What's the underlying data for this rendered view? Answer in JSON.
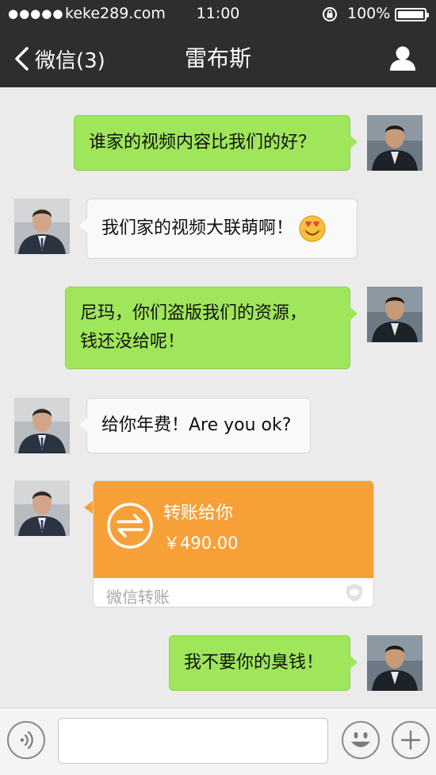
{
  "status_bar": {
    "signal": "●●●●●",
    "carrier": "keke289.com",
    "time": "11:00",
    "battery": "100%"
  },
  "nav": {
    "back_label": "微信(3)",
    "title": "雷布斯"
  },
  "messages": [
    {
      "sender": "me",
      "text": "谁家的视频内容比我们的好？"
    },
    {
      "sender": "friend",
      "text": "我们家的视频大联萌啊！",
      "emoji": "smiling-heart-eyes-emoji"
    },
    {
      "sender": "me",
      "line1": "尼玛，你们盗版我们的资源，",
      "line2": "钱还没给呢！"
    },
    {
      "sender": "friend",
      "text": "给你年费！Are you ok?"
    },
    {
      "sender": "friend",
      "type": "transfer",
      "title": "转账给你",
      "amount": "￥490.00",
      "footer": "微信转账"
    },
    {
      "sender": "me",
      "text": "我不要你的臭钱！"
    }
  ],
  "colors": {
    "header_bg": "#2e2e30",
    "chat_bg": "#ebebeb",
    "green_bubble": "#9fe65a",
    "white_bubble": "#f9f9f9",
    "transfer_orange": "#f8a038"
  },
  "icons": [
    "back-chevron-icon",
    "profile-icon",
    "voice-icon",
    "emoji-icon",
    "plus-icon",
    "transfer-arrows-icon",
    "wechat-pay-icon"
  ]
}
